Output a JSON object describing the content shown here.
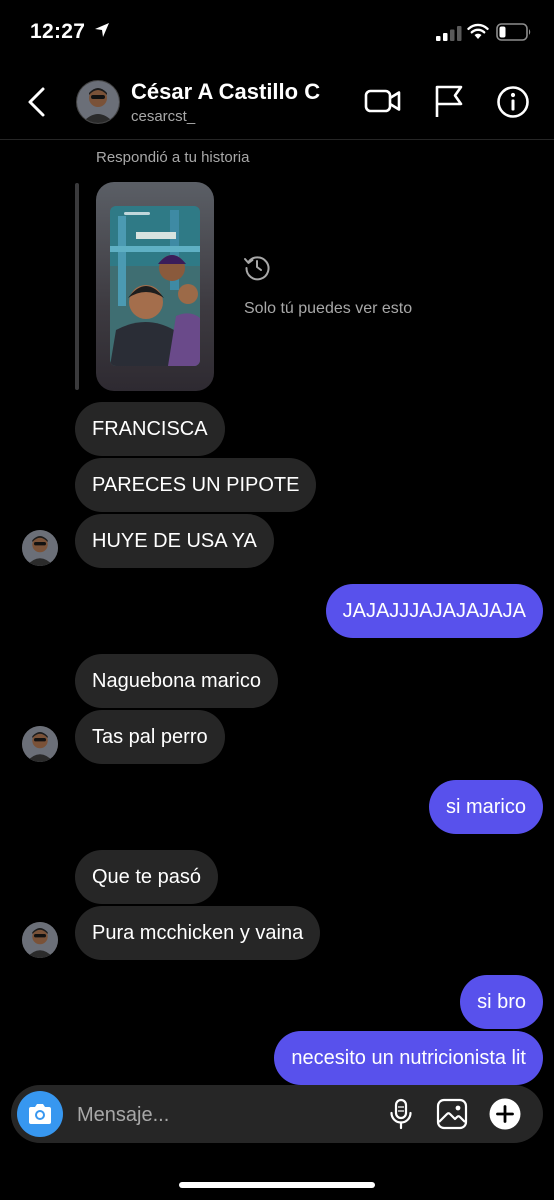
{
  "status_bar": {
    "time": "12:27"
  },
  "header": {
    "name": "César A Castillo C",
    "username": "cesarcst_"
  },
  "story_reply": {
    "caption": "Respondió a tu historia",
    "private_note": "Solo tú puedes ver esto"
  },
  "messages": [
    {
      "side": "received",
      "text": "FRANCISCA"
    },
    {
      "side": "received",
      "text": "PARECES UN PIPOTE"
    },
    {
      "side": "received",
      "text": "HUYE DE USA YA"
    },
    {
      "side": "sent",
      "text": "JAJAJJJAJAJAJAJA"
    },
    {
      "side": "received",
      "text": "Naguebona marico"
    },
    {
      "side": "received",
      "text": "Tas pal perro"
    },
    {
      "side": "sent",
      "text": "si marico"
    },
    {
      "side": "received",
      "text": "Que te pasó"
    },
    {
      "side": "received",
      "text": "Pura mcchicken y vaina"
    },
    {
      "side": "sent",
      "text": "si bro"
    },
    {
      "side": "sent",
      "text": "necesito un nutricionista lit"
    }
  ],
  "composer": {
    "placeholder": "Mensaje..."
  },
  "colors": {
    "background": "#000000",
    "received_bubble": "#262626",
    "sent_bubble": "#5851ec",
    "camera_button": "#3797f0"
  },
  "icons": {
    "back": "chevron-left-icon",
    "video": "video-call-icon",
    "flag": "flag-icon",
    "info": "info-icon",
    "history": "history-icon",
    "camera": "camera-icon",
    "mic": "microphone-icon",
    "gallery": "gallery-icon",
    "plus": "plus-icon"
  }
}
